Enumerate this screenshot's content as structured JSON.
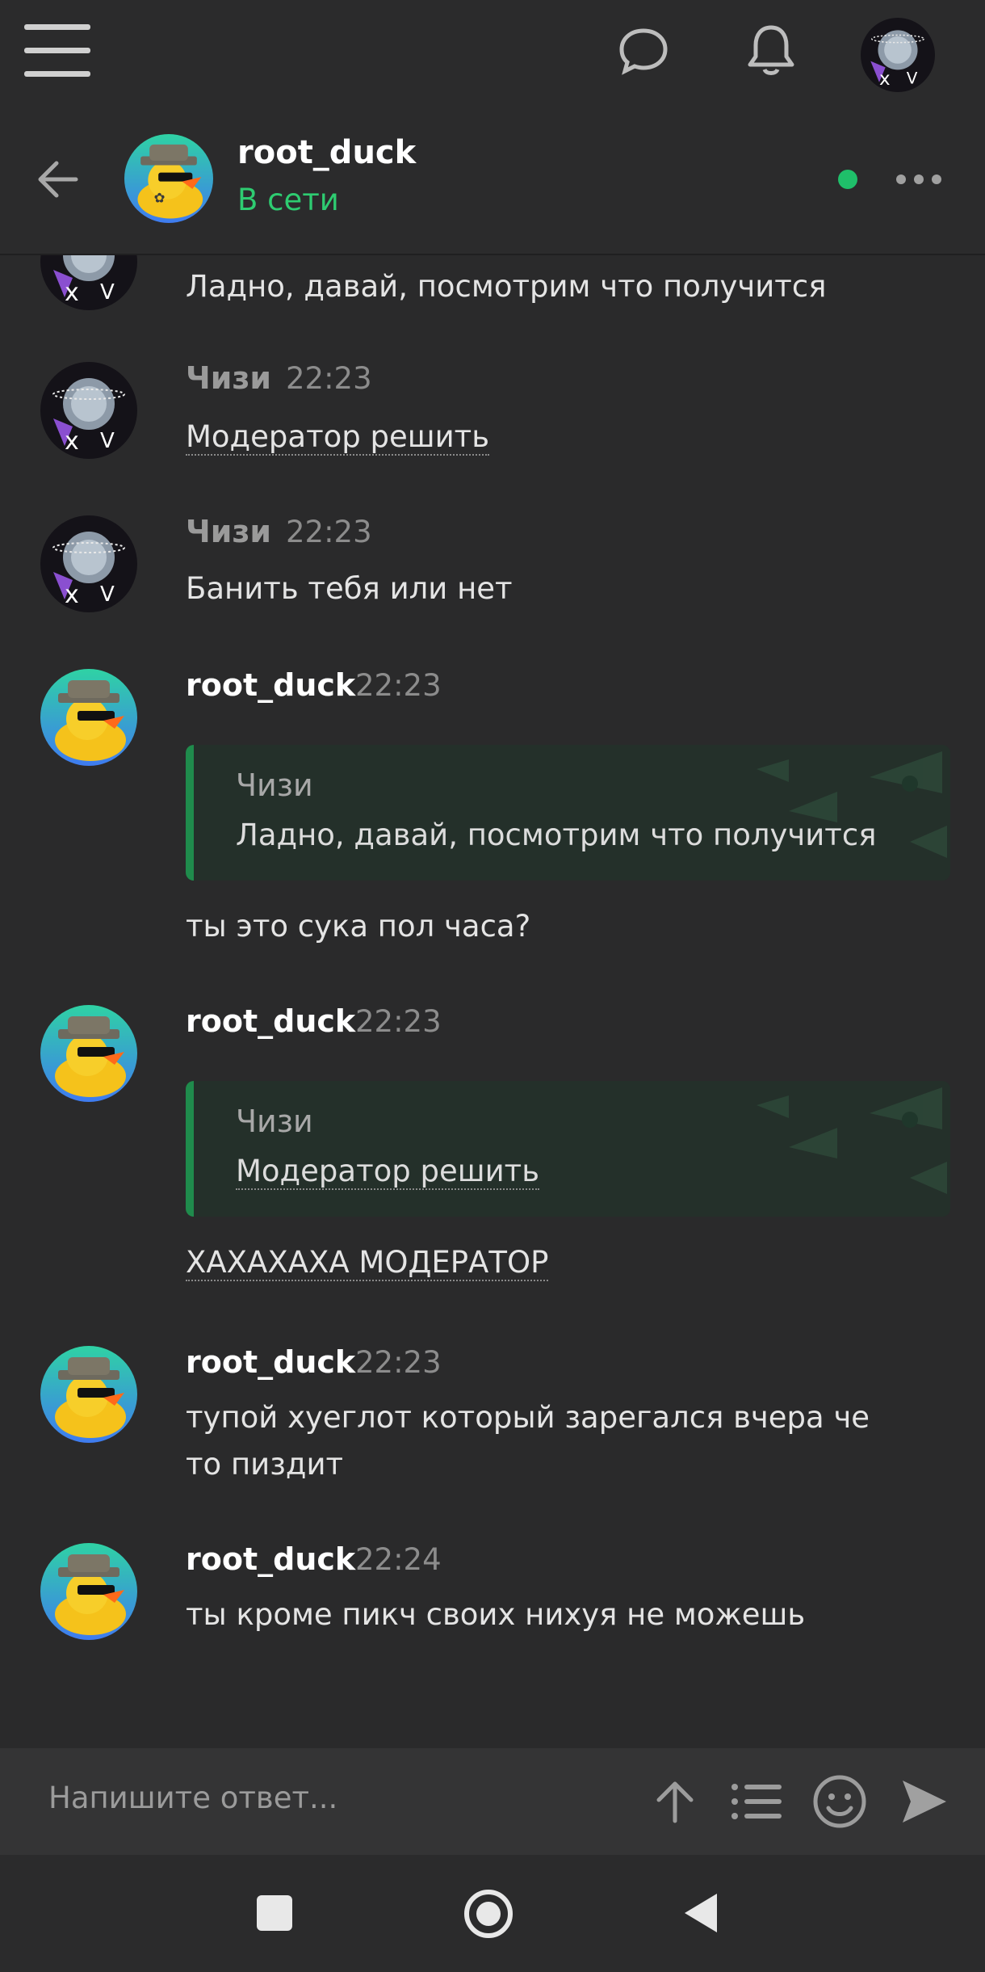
{
  "header": {
    "menu_icon": "hamburger-menu-icon",
    "chat_icon": "chat-bubble-icon",
    "bell_icon": "bell-icon",
    "user_avatar": "user-avatar"
  },
  "chat": {
    "title": "root_duck",
    "status": "В сети",
    "status_color": "#2ecc71",
    "online_dot_color": "#1fbf6a"
  },
  "messages": [
    {
      "id": 0,
      "author": "",
      "time": "",
      "text": "Ладно, давай, посмотрим что получится"
    },
    {
      "id": 1,
      "author": "Чизи",
      "time": "22:23",
      "text": "Модератор решить"
    },
    {
      "id": 2,
      "author": "Чизи",
      "time": "22:23",
      "text": "Банить тебя или нет"
    },
    {
      "id": 3,
      "author": "root_duck",
      "time": "22:23",
      "quote_author": "Чизи",
      "quote_text": "Ладно, давай, посмотрим что получится",
      "text": "ты это сука пол часа?"
    },
    {
      "id": 4,
      "author": "root_duck",
      "time": "22:23",
      "quote_author": "Чизи",
      "quote_text": "Модератор решить",
      "text": "ХАХАХАХА МОДЕРАТОР"
    },
    {
      "id": 5,
      "author": "root_duck",
      "time": "22:23",
      "text": "тупой хуеглот который зарегался вчера че то пиздит"
    },
    {
      "id": 6,
      "author": "root_duck",
      "time": "22:24",
      "text": "ты кроме пикч своих нихуя не можешь"
    }
  ],
  "composer": {
    "placeholder": "Напишите ответ..."
  },
  "colors": {
    "background": "#2a2a2b",
    "accent": "#1f8b4c"
  }
}
